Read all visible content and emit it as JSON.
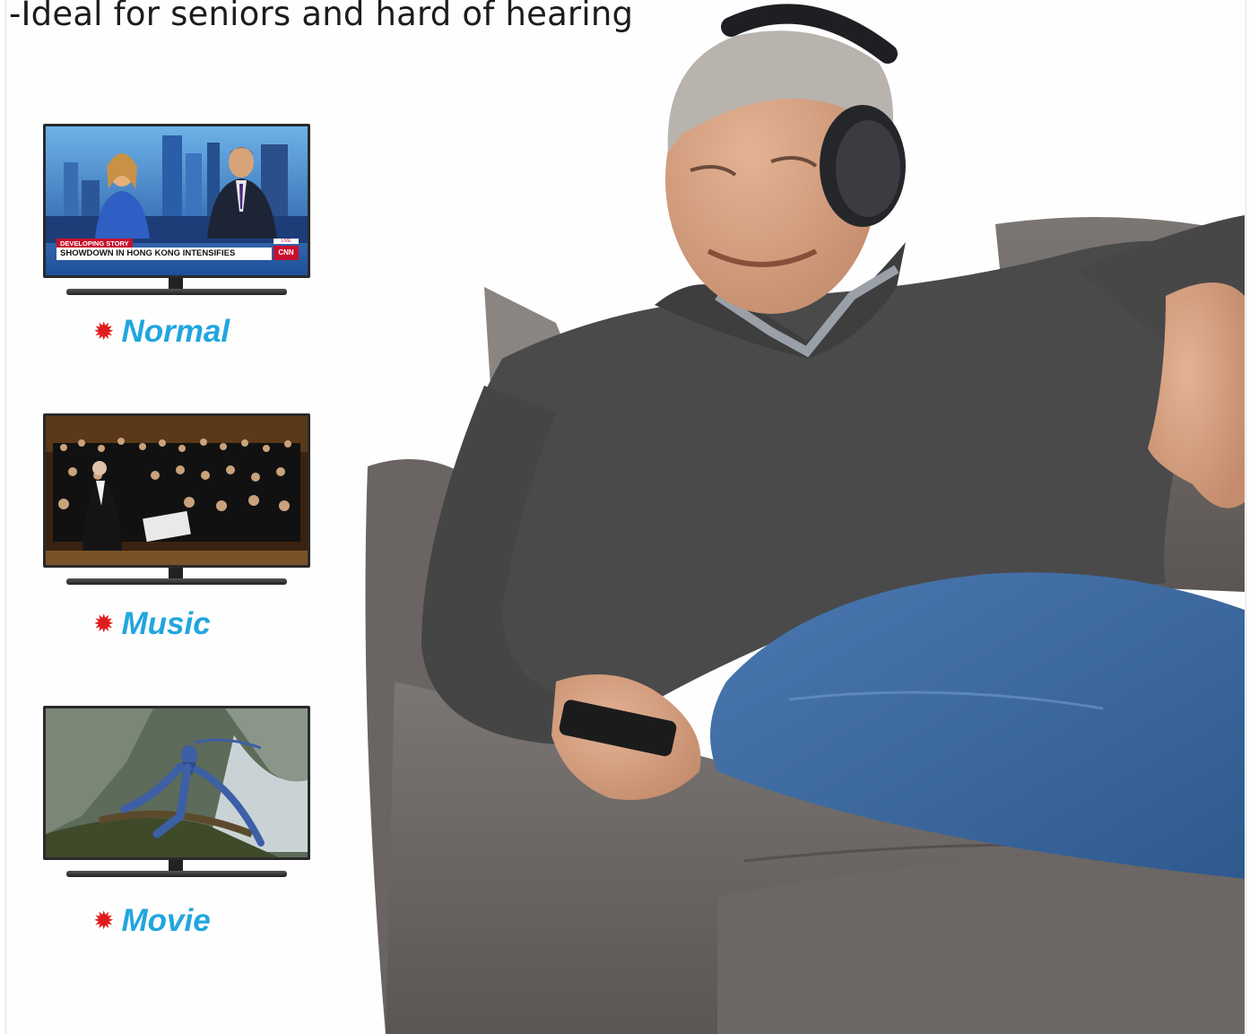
{
  "headline": "-Ideal for seniors and hard of hearing",
  "modes": [
    {
      "label": "Normal",
      "marker": "✹"
    },
    {
      "label": "Music",
      "marker": "✹"
    },
    {
      "label": "Movie",
      "marker": "✹"
    }
  ],
  "news_screen": {
    "developing": "DEVELOPING STORY",
    "headline": "SHOWDOWN IN HONG KONG INTENSIFIES",
    "live": "LIVE",
    "logo": "CNN"
  },
  "colors": {
    "label_blue": "#21a6de",
    "marker_red": "#e11c1c",
    "sweater": "#4a4a4b",
    "jeans": "#3d69a0",
    "sofa": "#6f6a67"
  },
  "icons": [
    "tv-monitor-icon",
    "star-burst-icon"
  ]
}
